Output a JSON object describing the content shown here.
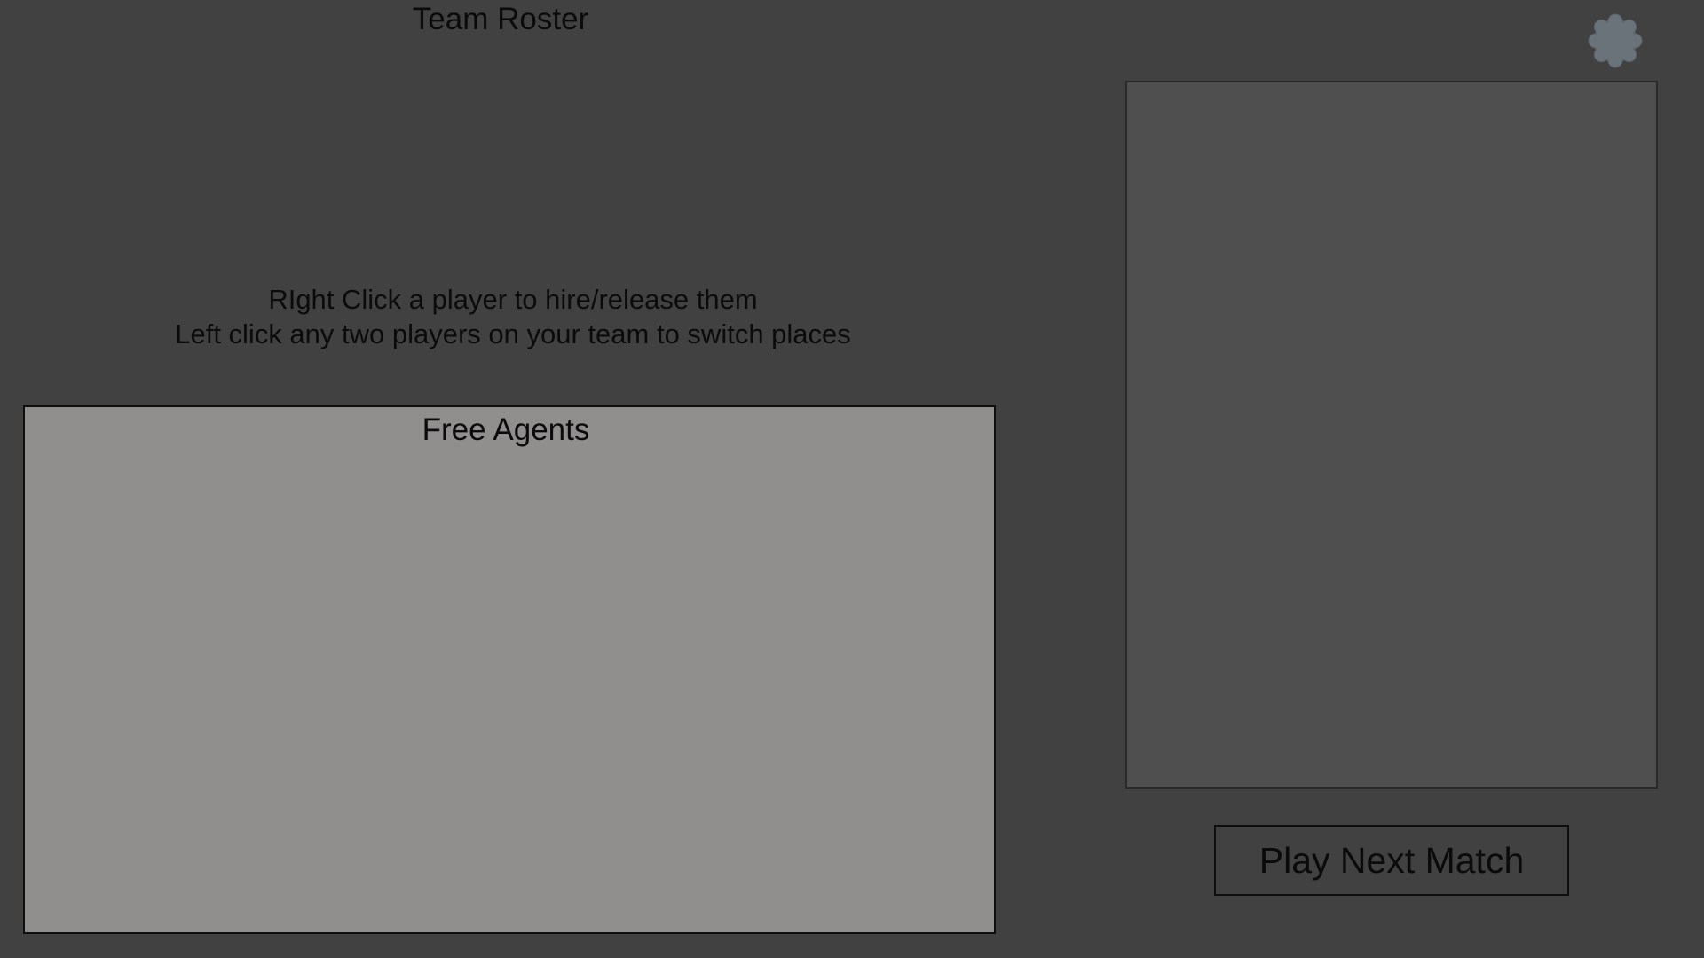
{
  "header": {
    "title": "Team Roster"
  },
  "instructions": {
    "line1": "RIght Click a player to hire/release them",
    "line2": "Left click any two players on your team to switch places"
  },
  "free_agents": {
    "title": "Free Agents",
    "players": []
  },
  "actions": {
    "play_next_match_label": "Play Next Match"
  },
  "icons": {
    "settings": "gear-icon"
  },
  "colors": {
    "background": "#414141",
    "free_agents_panel": "#908f8e",
    "detail_panel": "#4f4f4f",
    "gear": "#6b737a",
    "text": "#0b0b0b"
  }
}
